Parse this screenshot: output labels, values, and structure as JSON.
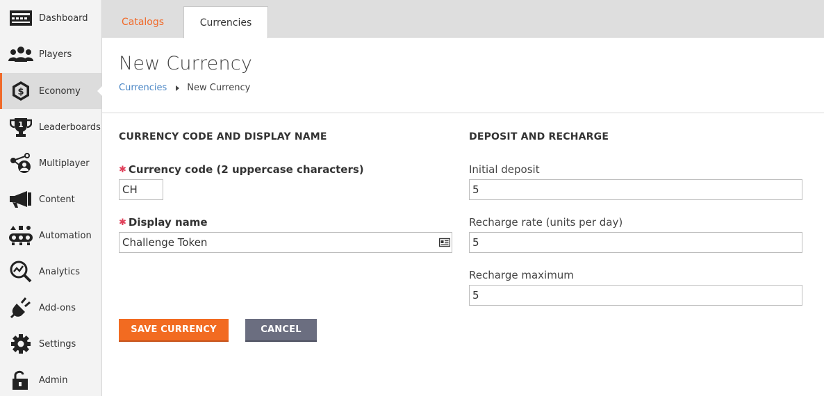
{
  "sidebar": {
    "items": [
      {
        "label": "Dashboard",
        "icon": "dashboard-icon"
      },
      {
        "label": "Players",
        "icon": "players-icon"
      },
      {
        "label": "Economy",
        "icon": "economy-icon",
        "active": true
      },
      {
        "label": "Leaderboards",
        "icon": "trophy-icon"
      },
      {
        "label": "Multiplayer",
        "icon": "multiplayer-icon"
      },
      {
        "label": "Content",
        "icon": "megaphone-icon"
      },
      {
        "label": "Automation",
        "icon": "automation-icon"
      },
      {
        "label": "Analytics",
        "icon": "analytics-icon"
      },
      {
        "label": "Add-ons",
        "icon": "plug-icon"
      },
      {
        "label": "Settings",
        "icon": "gear-icon"
      },
      {
        "label": "Admin",
        "icon": "lock-icon"
      }
    ]
  },
  "tabs": {
    "catalogs": "Catalogs",
    "currencies": "Currencies",
    "active": "Currencies"
  },
  "header": {
    "title": "New Currency",
    "breadcrumb_parent": "Currencies",
    "breadcrumb_current": "New Currency"
  },
  "left_section": {
    "heading": "CURRENCY CODE AND DISPLAY NAME",
    "currency_code_label": "Currency code (2 uppercase characters)",
    "currency_code_value": "CH",
    "display_name_label": "Display name",
    "display_name_value": "Challenge Token"
  },
  "right_section": {
    "heading": "DEPOSIT AND RECHARGE",
    "initial_deposit_label": "Initial deposit",
    "initial_deposit_value": "5",
    "recharge_rate_label": "Recharge rate (units per day)",
    "recharge_rate_value": "5",
    "recharge_max_label": "Recharge maximum",
    "recharge_max_value": "5"
  },
  "buttons": {
    "save": "SAVE CURRENCY",
    "cancel": "CANCEL"
  },
  "colors": {
    "accent": "#f26b21",
    "link": "#4a86c5",
    "required": "#e0405a",
    "cancel": "#6b6e80"
  }
}
